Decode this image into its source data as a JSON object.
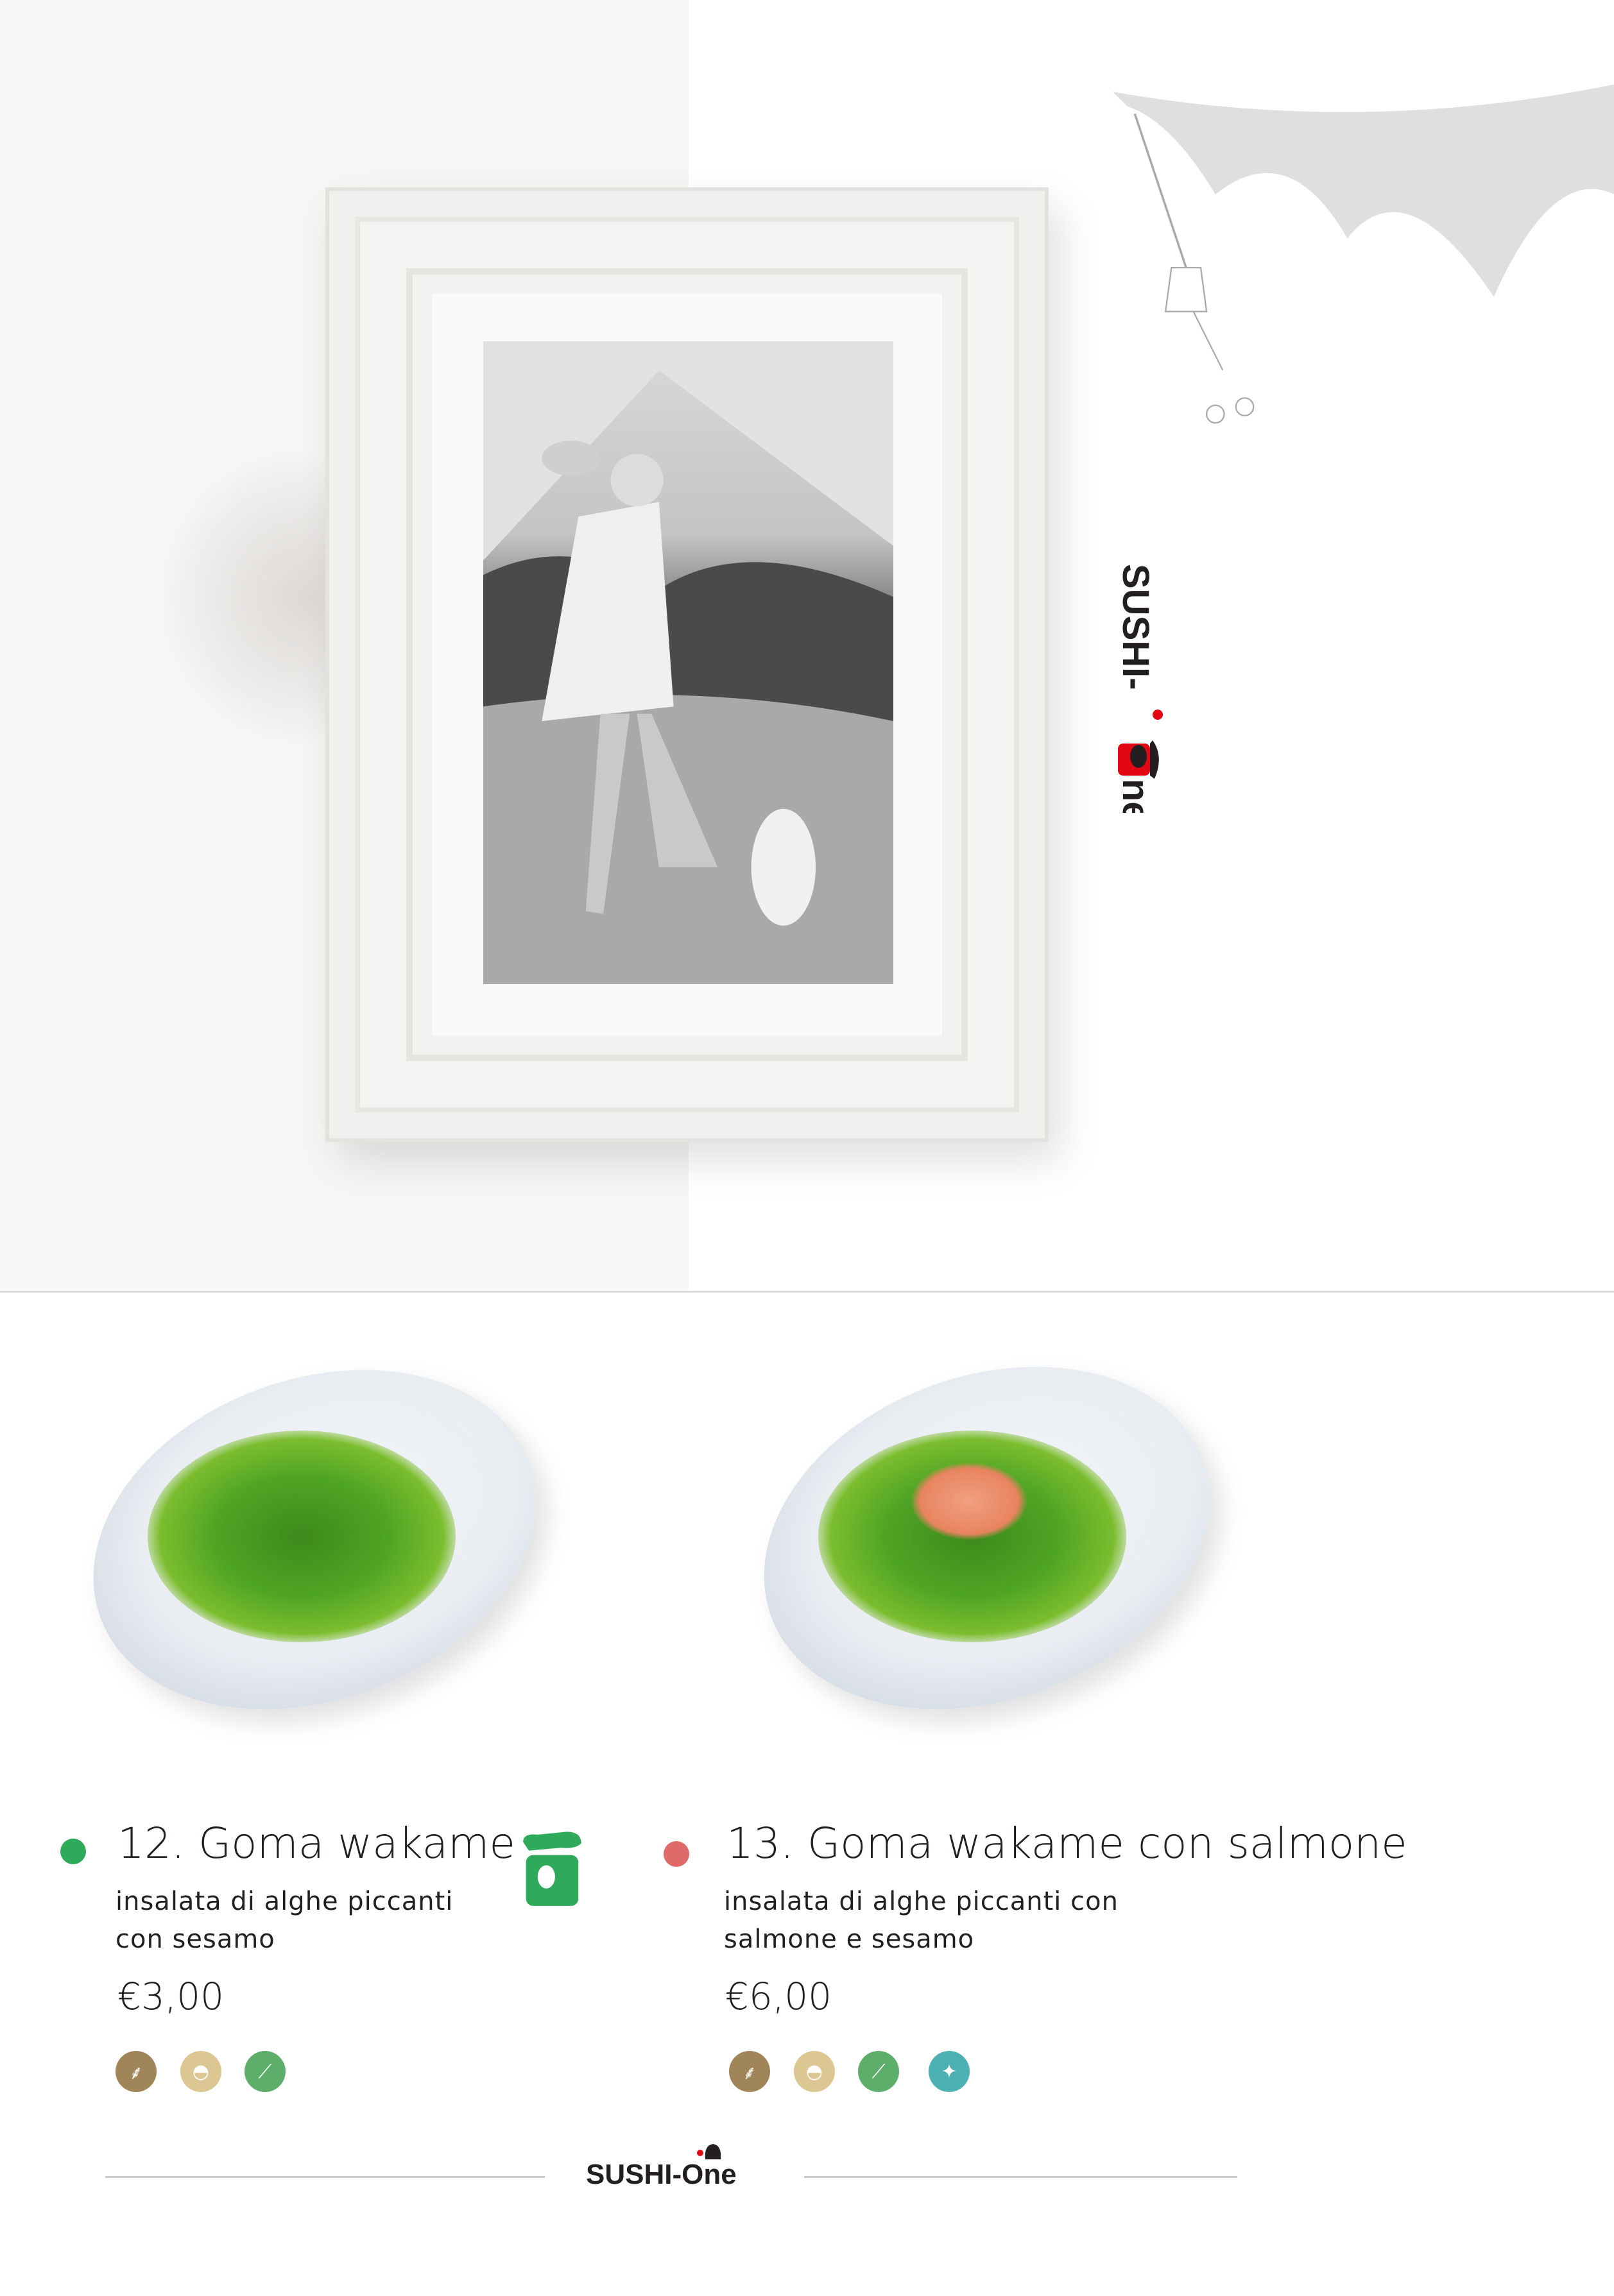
{
  "brand": {
    "name": "SUSHI-One"
  },
  "items": [
    {
      "number_title": "12. Goma wakame",
      "desc_line1": "insalata di alghe piccanti",
      "desc_line2": "con sesamo",
      "price": "€3,00",
      "dot_color": "#2eaa5a",
      "badge": "chef-recommended-icon",
      "allergens": [
        {
          "name": "gluten-wheat-icon",
          "color": "#a08559"
        },
        {
          "name": "rice-icon",
          "color": "#dcc793"
        },
        {
          "name": "soy-icon",
          "color": "#5eae6b"
        }
      ]
    },
    {
      "number_title": "13. Goma wakame con salmone",
      "desc_line1": "insalata di alghe piccanti con",
      "desc_line2": "salmone e sesamo",
      "price": "€6,00",
      "dot_color": "#e06a6a",
      "allergens": [
        {
          "name": "gluten-wheat-icon",
          "color": "#a08559"
        },
        {
          "name": "rice-icon",
          "color": "#dcc793"
        },
        {
          "name": "soy-icon",
          "color": "#5eae6b"
        },
        {
          "name": "fish-icon",
          "color": "#4db0b3"
        }
      ]
    }
  ]
}
